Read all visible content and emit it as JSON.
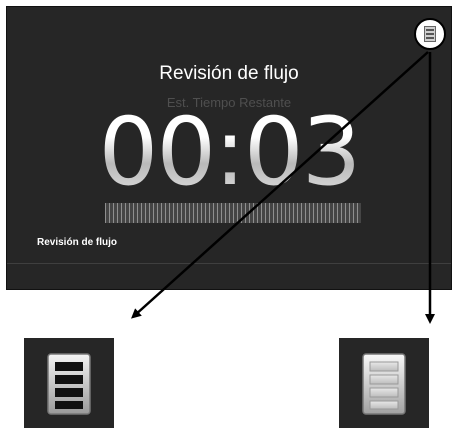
{
  "screen": {
    "title": "Revisión de flujo",
    "subtitle": "Est. Tiempo Restante",
    "timer": "00:03",
    "progress": 1.0,
    "footer_label": "Revisión de flujo"
  },
  "icons": {
    "menu": "menu-icon",
    "zoom_left": "menu-icon-outline",
    "zoom_right": "menu-icon-filled"
  },
  "colors": {
    "screen_bg": "#262626",
    "text_primary": "#ffffff",
    "text_muted": "#4f4f4f",
    "accent": "#8c8c8c"
  }
}
